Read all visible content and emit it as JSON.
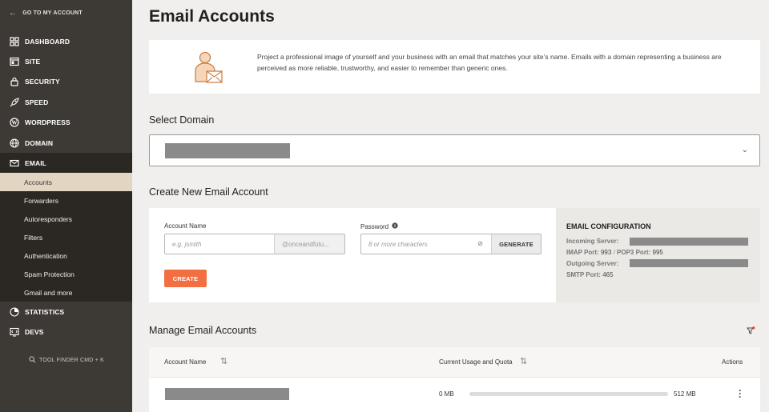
{
  "sidebar": {
    "back": "GO TO MY ACCOUNT",
    "items": [
      {
        "label": "DASHBOARD",
        "icon": "dashboard-icon"
      },
      {
        "label": "SITE",
        "icon": "site-icon"
      },
      {
        "label": "SECURITY",
        "icon": "lock-icon"
      },
      {
        "label": "SPEED",
        "icon": "rocket-icon"
      },
      {
        "label": "WORDPRESS",
        "icon": "wordpress-icon"
      },
      {
        "label": "DOMAIN",
        "icon": "globe-icon"
      },
      {
        "label": "EMAIL",
        "icon": "envelope-icon"
      }
    ],
    "email_sub": [
      "Accounts",
      "Forwarders",
      "Autoresponders",
      "Filters",
      "Authentication",
      "Spam Protection",
      "Gmail and more"
    ],
    "after": [
      {
        "label": "STATISTICS",
        "icon": "statistics-icon"
      },
      {
        "label": "DEVS",
        "icon": "devs-icon"
      }
    ],
    "tool_finder": "TOOL FINDER CMD + K"
  },
  "main": {
    "title": "Email Accounts",
    "intro": "Project a professional image of yourself and your business with an email that matches your site’s name. Emails with a domain representing a business are perceived as more reliable, trustworthy, and easier to remember than generic ones.",
    "select_domain_title": "Select Domain",
    "create_title": "Create New Email Account",
    "account_label": "Account Name",
    "account_placeholder": "e.g. jsmith",
    "account_suffix": "@onceandfutu...",
    "password_label": "Password",
    "password_placeholder": "8 or more characters",
    "generate": "GENERATE",
    "create": "CREATE",
    "config": {
      "title": "EMAIL CONFIGURATION",
      "incoming": "Incoming Server:",
      "imap_label": "IMAP Port:",
      "imap_val": "993",
      "pop3_label": "POP3 Port:",
      "pop3_val": "995",
      "outgoing": "Outgoing Server:",
      "smtp_label": "SMTP Port:",
      "smtp_val": "465"
    },
    "manage_title": "Manage Email Accounts",
    "table": {
      "col_account": "Account Name",
      "col_usage": "Current Usage and Quota",
      "col_actions": "Actions",
      "rows": [
        {
          "usage": "0 MB",
          "quota": "512 MB",
          "fraction": 0
        }
      ]
    }
  },
  "colors": {
    "accent": "#f36f42",
    "sidebar": "#3d3934",
    "active_sub": "#e2d5c1"
  }
}
